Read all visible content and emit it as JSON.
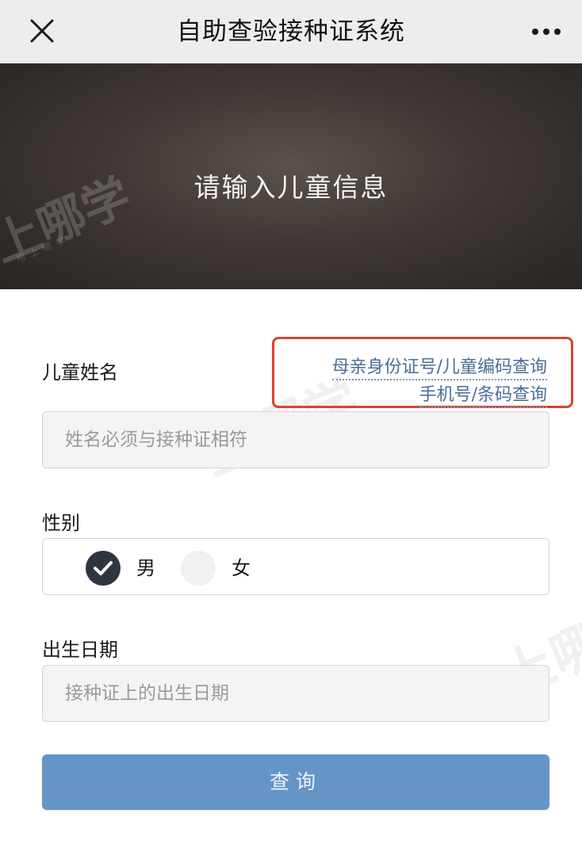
{
  "nav": {
    "title": "自助查验接种证系统",
    "close_icon": "close-icon",
    "more_icon": "more-dots-icon"
  },
  "banner": {
    "title": "请输入儿童信息"
  },
  "watermark": {
    "main": "上哪学",
    "sub": "用上哪学"
  },
  "form": {
    "name_label": "儿童姓名",
    "name_placeholder": "姓名必须与接种证相符",
    "name_value": "",
    "links": [
      "母亲身份证号/儿童编码查询",
      "手机号/条码查询"
    ],
    "gender_label": "性别",
    "gender_options": [
      {
        "label": "男",
        "selected": true
      },
      {
        "label": "女",
        "selected": false
      }
    ],
    "birth_label": "出生日期",
    "birth_placeholder": "接种证上的出生日期",
    "birth_value": "",
    "submit_label": "查询"
  },
  "colors": {
    "navbar_bg": "#ededed",
    "link": "#4a6f96",
    "highlight_border": "#d9432f",
    "submit_bg": "#6594c6",
    "radio_selected": "#2e3440",
    "radio_unselected": "#f0f0f0"
  }
}
